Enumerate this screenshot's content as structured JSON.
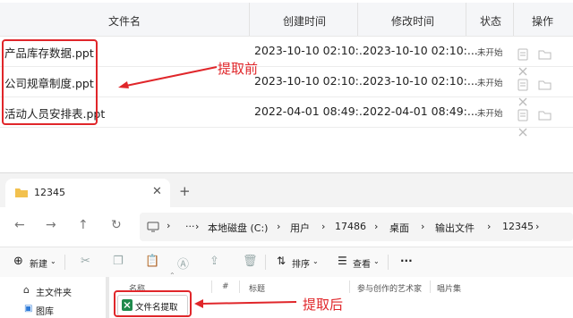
{
  "table": {
    "headers": {
      "filename": "文件名",
      "created": "创建时间",
      "modified": "修改时间",
      "status": "状态",
      "action": "操作"
    },
    "rows": [
      {
        "filename": "产品库存数据.ppt",
        "created": "2023-10-10 02:10:...",
        "modified": "2023-10-10 02:10:...",
        "status": "未开始"
      },
      {
        "filename": "公司规章制度.ppt",
        "created": "2023-10-10 02:10:...",
        "modified": "2023-10-10 02:10:...",
        "status": "未开始"
      },
      {
        "filename": "活动人员安排表.ppt",
        "created": "2022-04-01 08:49:...",
        "modified": "2022-04-01 08:49:...",
        "status": "未开始"
      }
    ]
  },
  "annotations": {
    "before": "提取前",
    "after": "提取后",
    "color": "#e0262a"
  },
  "explorer": {
    "tab_title": "12345",
    "breadcrumb": [
      "本地磁盘 (C:)",
      "用户",
      "17486",
      "桌面",
      "输出文件",
      "12345"
    ],
    "more": "···",
    "toolbar": {
      "new_label": "新建",
      "sort_label": "排序",
      "view_label": "查看",
      "more": "···"
    },
    "sidebar": [
      {
        "label": "主文件夹",
        "icon": "home-icon"
      },
      {
        "label": "图库",
        "icon": "gallery-icon"
      }
    ],
    "columns": [
      "名称",
      "#",
      "标题",
      "参与创作的艺术家",
      "唱片集"
    ],
    "file": {
      "name": "文件名提取",
      "icon": "excel-file-icon"
    }
  }
}
